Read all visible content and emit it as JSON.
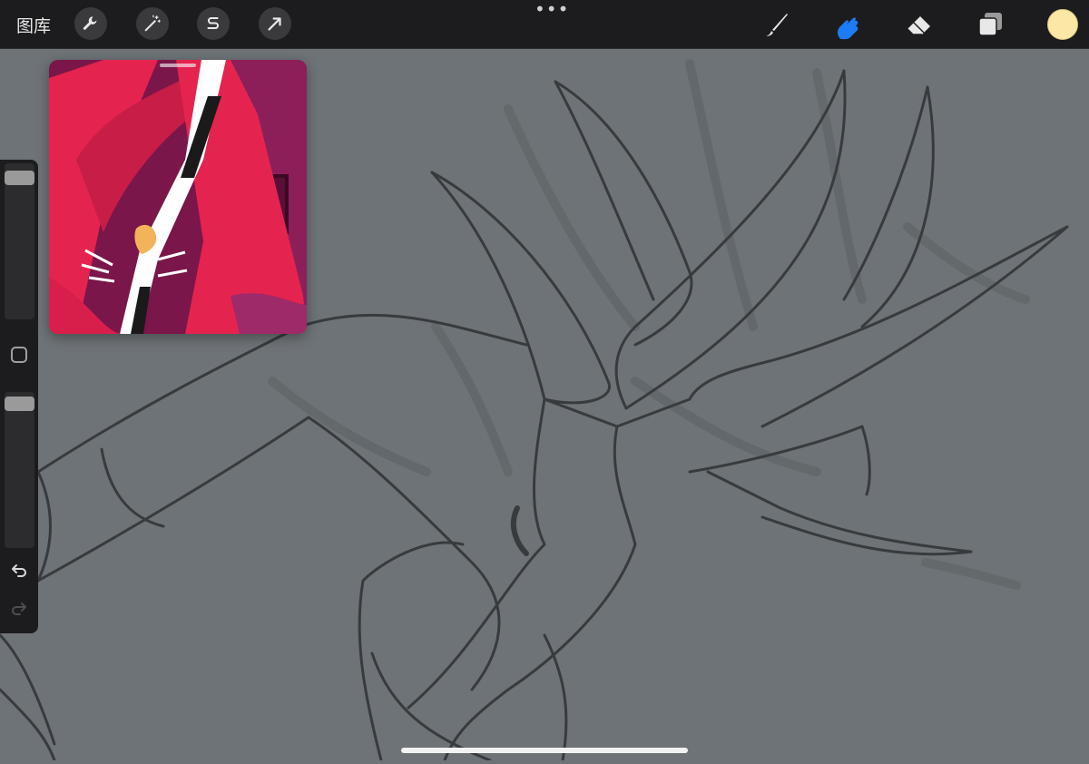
{
  "topbar": {
    "gallery_label": "图库",
    "more_dots": "•••",
    "left_tools": [
      {
        "name": "actions",
        "icon": "wrench-icon"
      },
      {
        "name": "adjustments",
        "icon": "magic-wand-icon"
      },
      {
        "name": "selection",
        "icon": "selection-s-icon"
      },
      {
        "name": "transform",
        "icon": "arrow-cursor-icon"
      }
    ],
    "right_tools": [
      {
        "name": "brush",
        "icon": "brush-icon"
      },
      {
        "name": "smudge",
        "icon": "smudge-finger-icon",
        "active": true
      },
      {
        "name": "eraser",
        "icon": "eraser-icon"
      },
      {
        "name": "layers",
        "icon": "layers-icon"
      }
    ],
    "active_tool_color": "#1b7cf5",
    "current_color": "#fde7a6"
  },
  "sidebar": {
    "brush_size_level": 0.95,
    "opacity_level": 0.97,
    "modify_icon": "square-modify-icon",
    "undo_icon": "undo-arrow-icon",
    "redo_icon": "redo-arrow-icon"
  },
  "reference": {
    "colors": [
      "#7a1649",
      "#e5234f",
      "#ffffff",
      "#f3b35a"
    ]
  },
  "canvas": {
    "background": "#6e7377",
    "stroke_color": "#3a3d40"
  }
}
